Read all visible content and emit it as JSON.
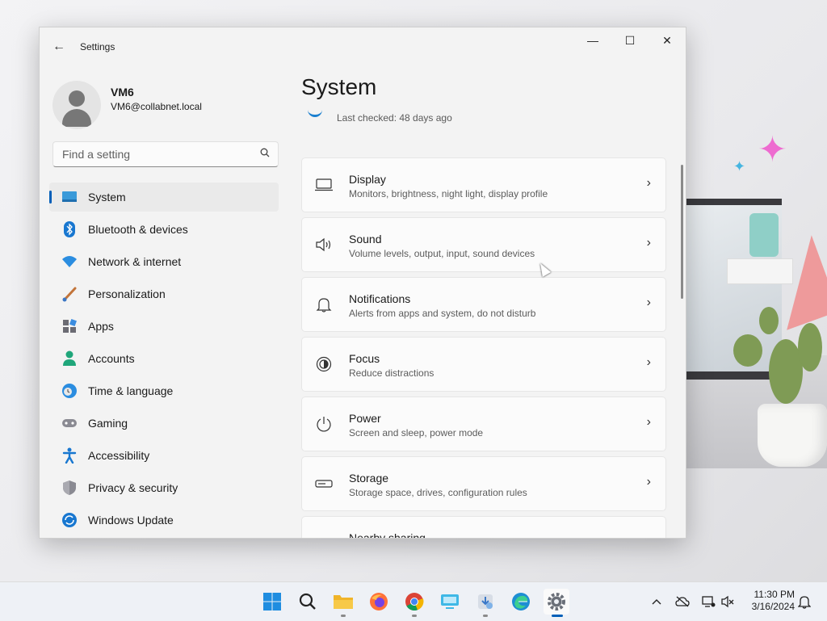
{
  "window": {
    "title": "Settings",
    "minimize_glyph": "—",
    "maximize_glyph": "☐",
    "close_glyph": "✕",
    "back_glyph": "←"
  },
  "profile": {
    "name": "VM6",
    "email": "VM6@collabnet.local"
  },
  "search": {
    "placeholder": "Find a setting",
    "icon": "search-icon"
  },
  "sidebar": {
    "items": [
      {
        "label": "System",
        "icon": "system-icon",
        "active": true
      },
      {
        "label": "Bluetooth & devices",
        "icon": "bluetooth-icon"
      },
      {
        "label": "Network & internet",
        "icon": "wifi-icon"
      },
      {
        "label": "Personalization",
        "icon": "brush-icon"
      },
      {
        "label": "Apps",
        "icon": "apps-icon"
      },
      {
        "label": "Accounts",
        "icon": "accounts-icon"
      },
      {
        "label": "Time & language",
        "icon": "time-language-icon"
      },
      {
        "label": "Gaming",
        "icon": "gamepad-icon"
      },
      {
        "label": "Accessibility",
        "icon": "accessibility-icon"
      },
      {
        "label": "Privacy & security",
        "icon": "shield-icon"
      },
      {
        "label": "Windows Update",
        "icon": "windows-update-icon"
      }
    ]
  },
  "main": {
    "title": "System",
    "update_status": "Last checked: 48 days ago",
    "cards": [
      {
        "title": "Display",
        "subtitle": "Monitors, brightness, night light, display profile",
        "icon": "display-icon"
      },
      {
        "title": "Sound",
        "subtitle": "Volume levels, output, input, sound devices",
        "icon": "speaker-icon"
      },
      {
        "title": "Notifications",
        "subtitle": "Alerts from apps and system, do not disturb",
        "icon": "bell-icon"
      },
      {
        "title": "Focus",
        "subtitle": "Reduce distractions",
        "icon": "focus-icon"
      },
      {
        "title": "Power",
        "subtitle": "Screen and sleep, power mode",
        "icon": "power-icon"
      },
      {
        "title": "Storage",
        "subtitle": "Storage space, drives, configuration rules",
        "icon": "storage-icon"
      },
      {
        "title": "Nearby sharing",
        "subtitle": "",
        "icon": "share-icon"
      }
    ]
  },
  "taskbar": {
    "apps": [
      {
        "name": "start-button",
        "icon": "windows-logo-icon"
      },
      {
        "name": "search-button",
        "icon": "search-icon"
      },
      {
        "name": "file-explorer-button",
        "icon": "folder-icon"
      },
      {
        "name": "firefox-button",
        "icon": "firefox-icon"
      },
      {
        "name": "chrome-button",
        "icon": "chrome-icon"
      },
      {
        "name": "remote-desktop-button",
        "icon": "remote-desktop-icon"
      },
      {
        "name": "app-installer-button",
        "icon": "installer-icon"
      },
      {
        "name": "edge-button",
        "icon": "edge-icon"
      },
      {
        "name": "settings-button",
        "icon": "gear-icon",
        "active": true
      }
    ],
    "tray": {
      "time": "11:30 PM",
      "date": "3/16/2024"
    }
  },
  "colors": {
    "accent": "#005fb8",
    "window_bg": "#f3f3f3",
    "card_bg": "#fbfbfb"
  }
}
